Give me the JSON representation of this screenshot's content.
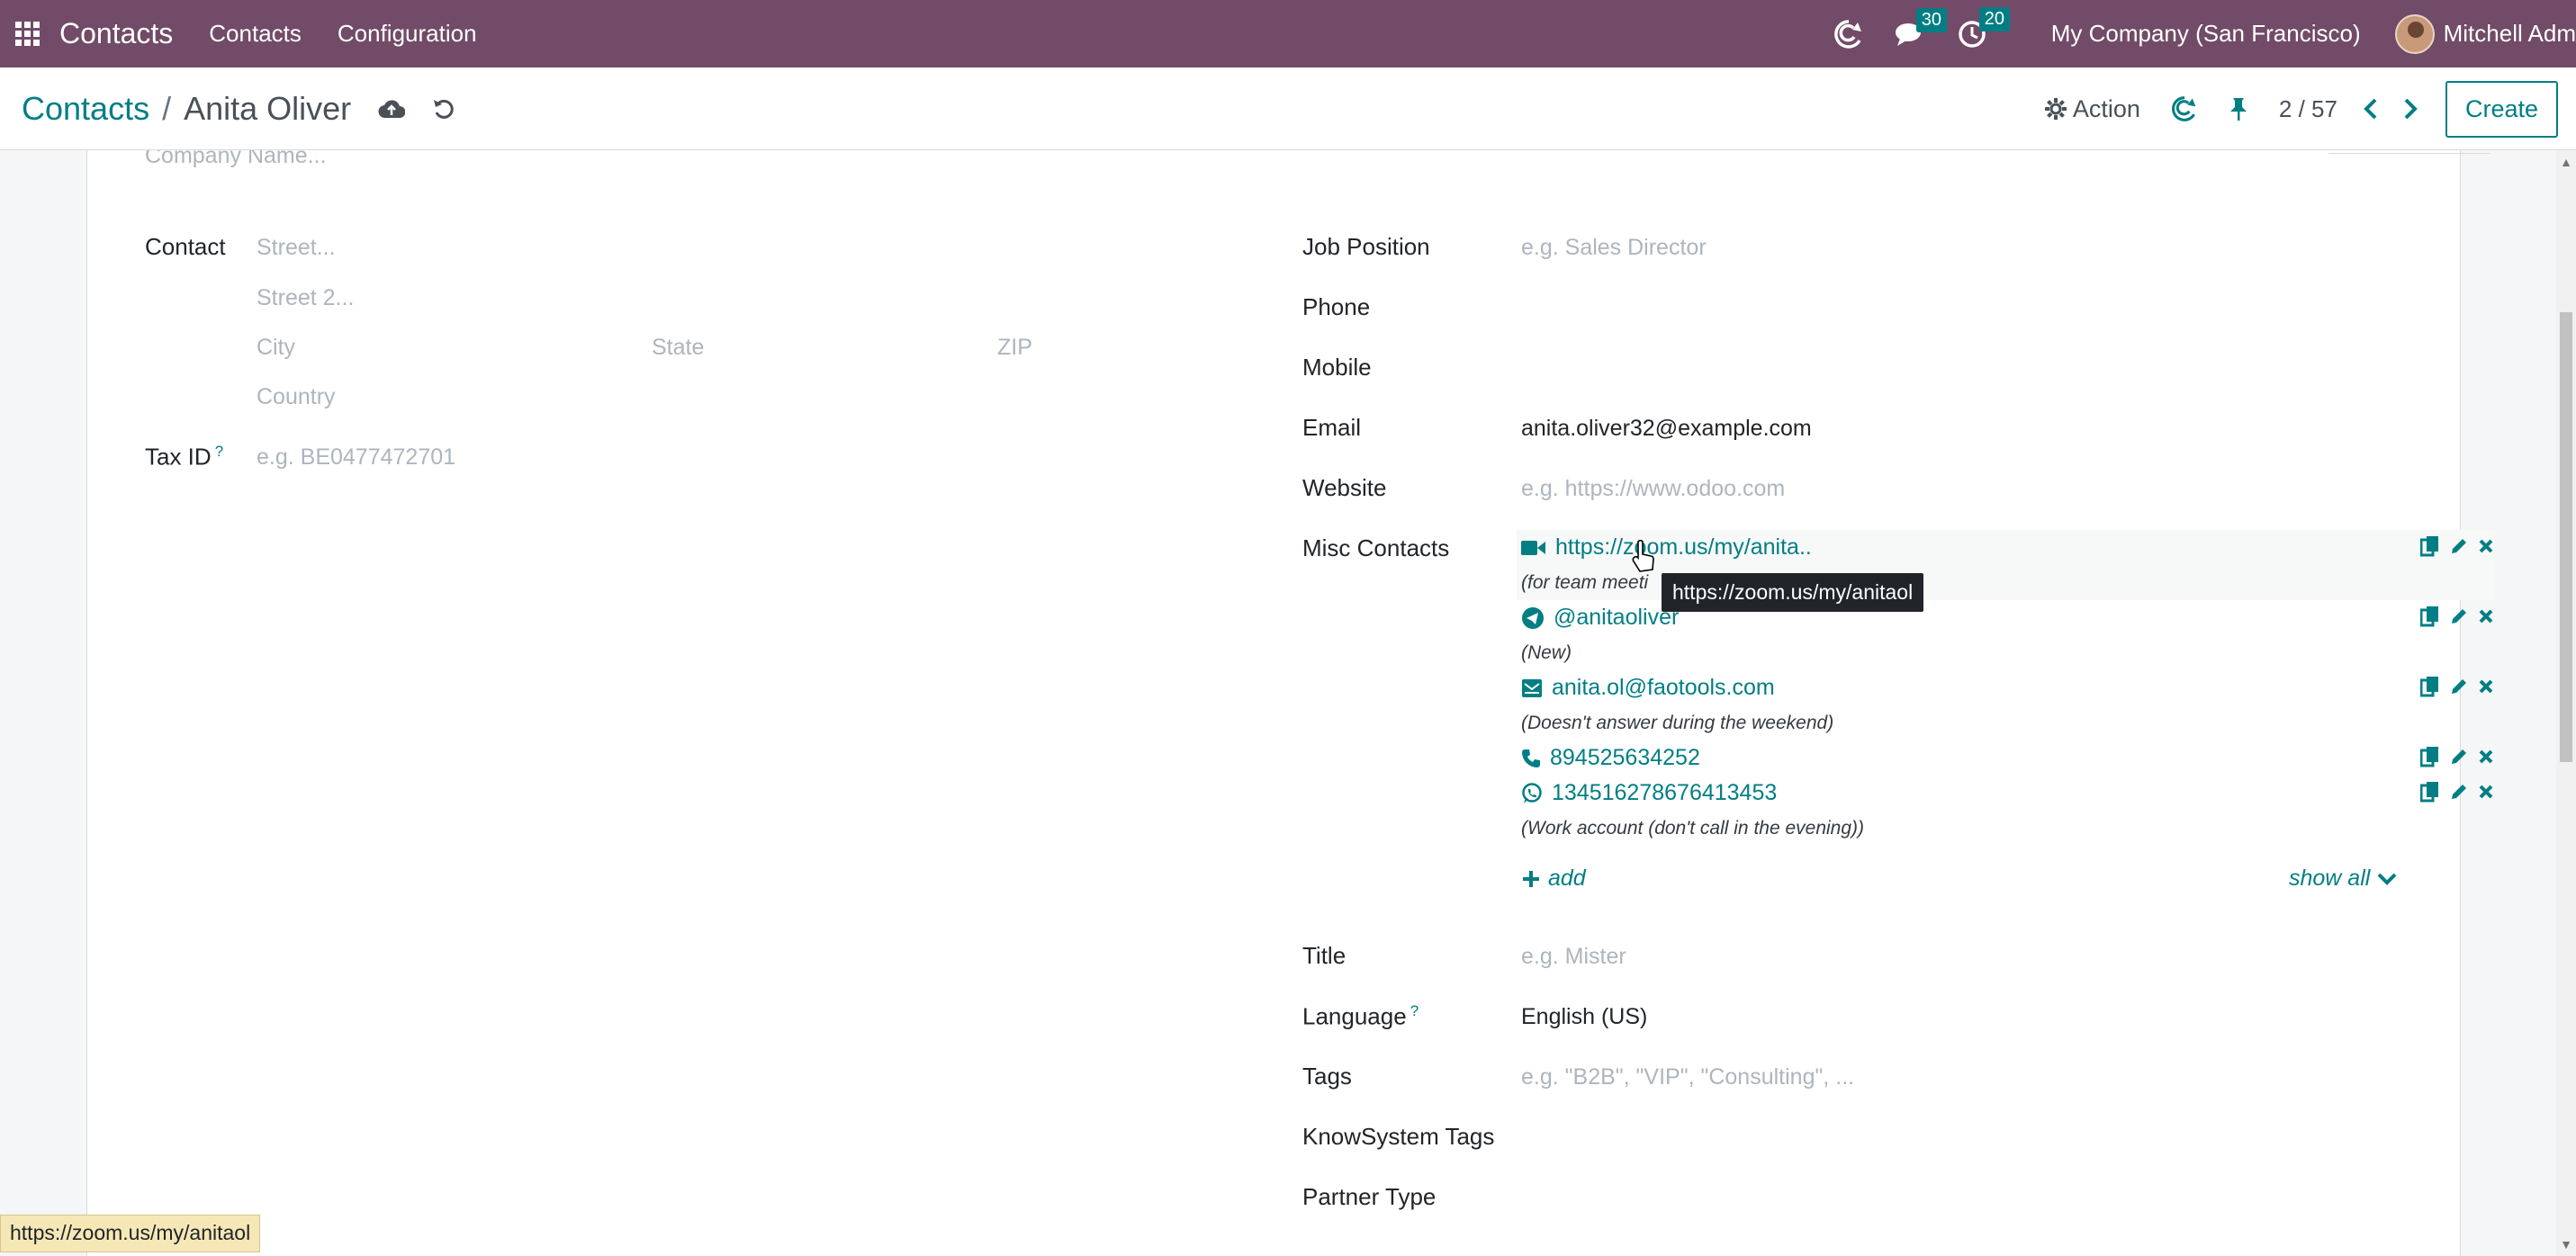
{
  "navbar": {
    "brand": "Contacts",
    "menu": [
      "Contacts",
      "Configuration"
    ],
    "messages_count": "30",
    "activities_count": "20",
    "company": "My Company (San Francisco)",
    "user": "Mitchell Adm"
  },
  "control_panel": {
    "breadcrumb_parent": "Contacts",
    "breadcrumb_sep": "/",
    "breadcrumb_current": "Anita Oliver",
    "action_label": "Action",
    "pager": "2 / 57",
    "create_label": "Create"
  },
  "form": {
    "company_name_placeholder": "Company Name...",
    "contact_label": "Contact",
    "street_placeholder": "Street...",
    "street2_placeholder": "Street 2...",
    "city_placeholder": "City",
    "state_placeholder": "State",
    "zip_placeholder": "ZIP",
    "country_placeholder": "Country",
    "tax_id_label": "Tax ID",
    "tax_id_help": "?",
    "tax_id_placeholder": "e.g. BE0477472701",
    "job_position_label": "Job Position",
    "job_position_placeholder": "e.g. Sales Director",
    "phone_label": "Phone",
    "mobile_label": "Mobile",
    "email_label": "Email",
    "email_value": "anita.oliver32@example.com",
    "website_label": "Website",
    "website_placeholder": "e.g. https://www.odoo.com",
    "misc_contacts_label": "Misc Contacts",
    "misc_contacts": [
      {
        "icon": "video-camera-icon",
        "value": "https://zoom.us/my/anita..",
        "note": "(for team meeti"
      },
      {
        "icon": "telegram-icon",
        "value": "@anitaoliver",
        "note": "(New)"
      },
      {
        "icon": "envelope-icon",
        "value": "anita.ol@faotools.com",
        "note": "(Doesn't answer during the weekend)"
      },
      {
        "icon": "phone-icon",
        "value": "894525634252",
        "note": ""
      },
      {
        "icon": "whatsapp-icon",
        "value": "134516278676413453",
        "note": "(Work account (don't call in the evening))"
      }
    ],
    "add_label": "add",
    "show_all_label": "show all",
    "title_label": "Title",
    "title_placeholder": "e.g. Mister",
    "language_label": "Language",
    "language_help": "?",
    "language_value": "English (US)",
    "tags_label": "Tags",
    "tags_placeholder": "e.g. \"B2B\", \"VIP\", \"Consulting\", ...",
    "knowsystem_tags_label": "KnowSystem Tags",
    "partner_type_label": "Partner Type"
  },
  "tooltip": "https://zoom.us/my/anitaol",
  "statusbar": "https://zoom.us/my/anitaol",
  "colors": {
    "navbar": "#714b67",
    "accent": "#017e84",
    "badge": "#017e84"
  }
}
